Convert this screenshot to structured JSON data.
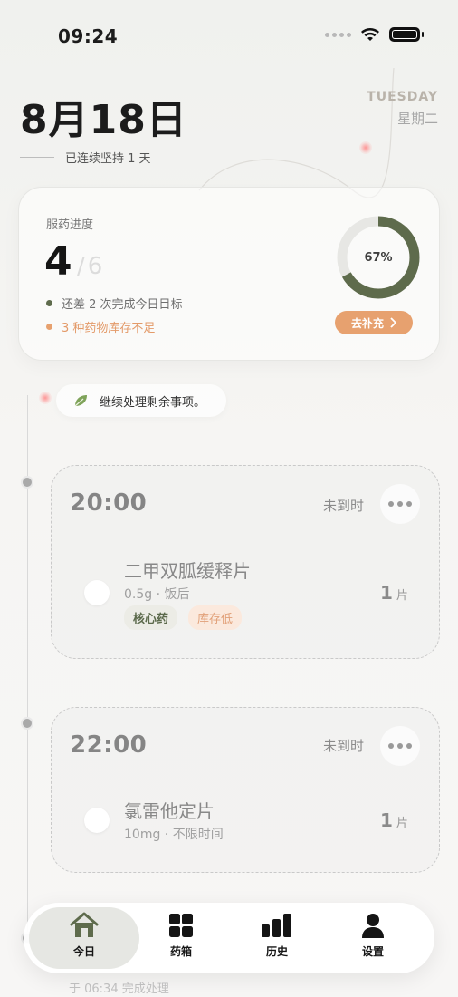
{
  "status_bar": {
    "time": "09:24"
  },
  "header": {
    "date": "8月18日",
    "weekday_en": "TUESDAY",
    "weekday_cn": "星期二",
    "streak": "已连续坚持 1 天"
  },
  "progress": {
    "label": "服药进度",
    "taken": "4",
    "total": "6",
    "remaining_text": "还差 2 次完成今日目标",
    "low_stock_text": "3 种药物库存不足",
    "percent_label": "67%",
    "percent_value": 0.67,
    "restock_button": "去补充",
    "colors": {
      "ring": "#5e6b4c",
      "accent": "#e7a16f"
    }
  },
  "hint": {
    "text": "继续处理剩余事项。",
    "icon": "leaf-icon"
  },
  "doses": [
    {
      "time": "20:00",
      "status": "未到时",
      "medicine": {
        "name": "二甲双胍缓释片",
        "detail": "0.5g · 饭后",
        "qty": "1",
        "unit": "片",
        "tags": [
          "核心药",
          "库存低"
        ]
      }
    },
    {
      "time": "22:00",
      "status": "未到时",
      "medicine": {
        "name": "氯雷他定片",
        "detail": "10mg · 不限时间",
        "qty": "1",
        "unit": "片"
      }
    }
  ],
  "partial_below": "于 06:34 完成处理",
  "tabs": [
    {
      "label": "今日",
      "icon": "home-icon",
      "active": true
    },
    {
      "label": "药箱",
      "icon": "grid-icon",
      "active": false
    },
    {
      "label": "历史",
      "icon": "bar-chart-icon",
      "active": false
    },
    {
      "label": "设置",
      "icon": "person-icon",
      "active": false
    }
  ]
}
